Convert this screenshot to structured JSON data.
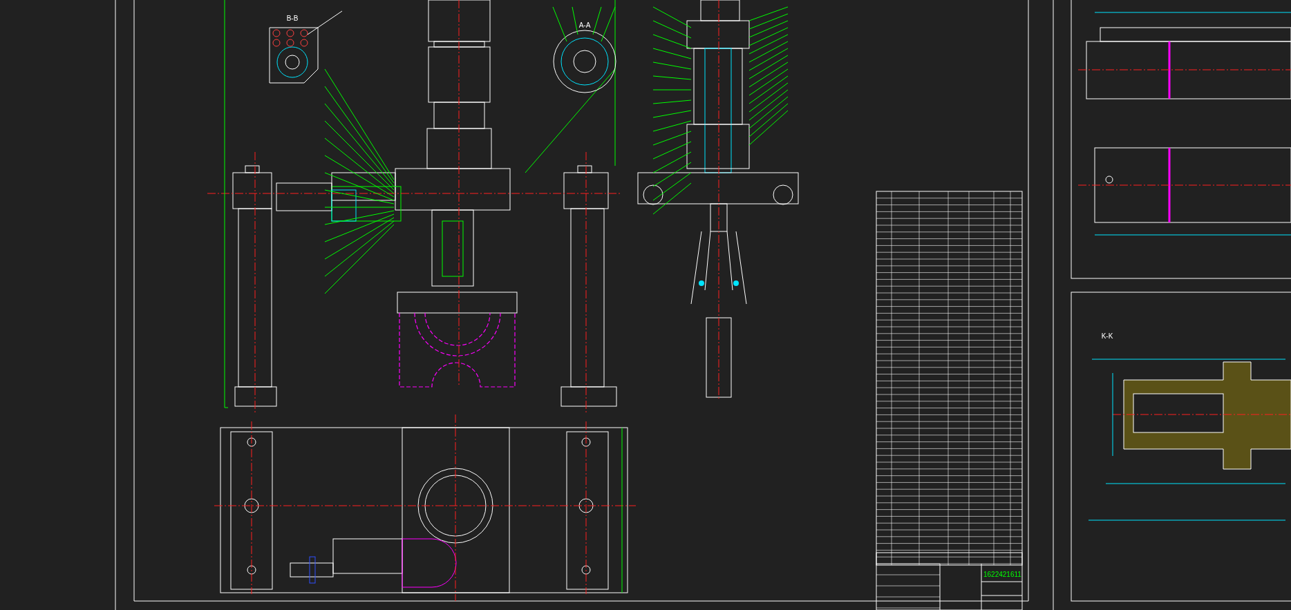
{
  "section_labels": [
    {
      "text": "B-B"
    },
    {
      "text": "A-A"
    },
    {
      "text": "K-K"
    }
  ],
  "title_block": {
    "drawing_number": "1622421611"
  }
}
